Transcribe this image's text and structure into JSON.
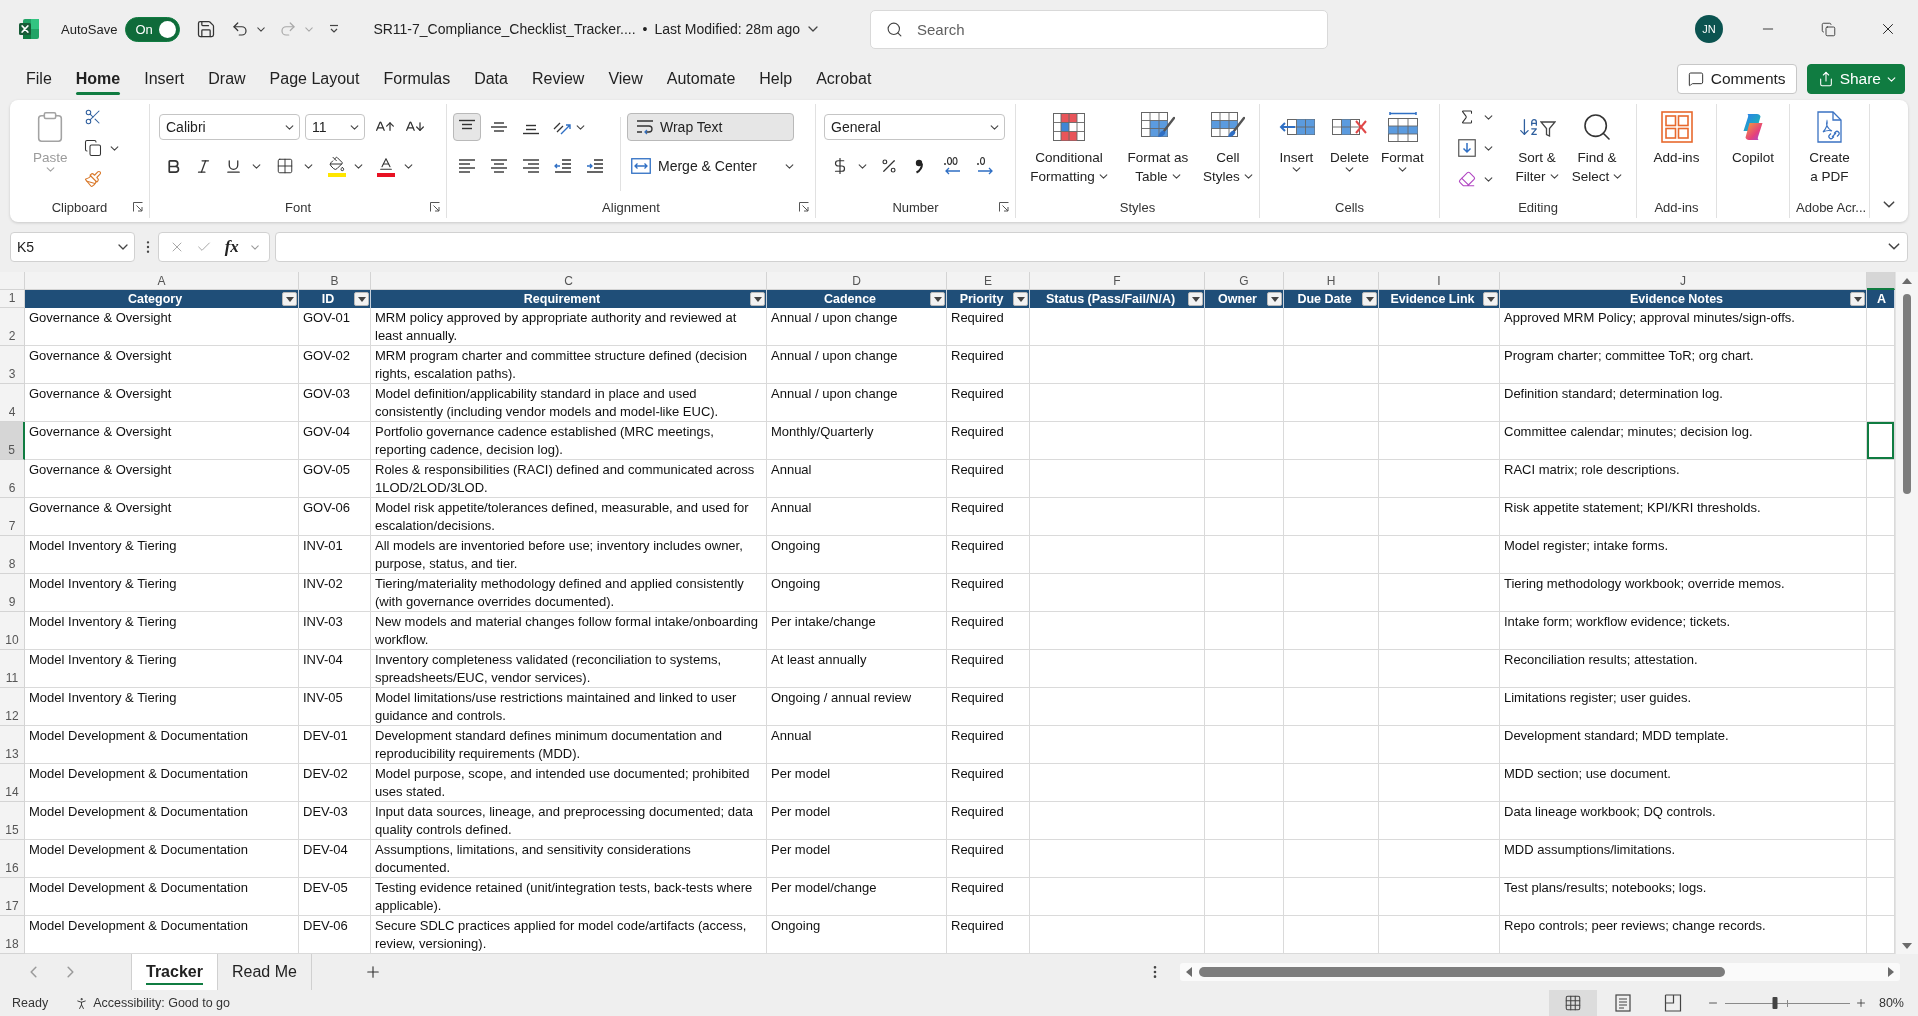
{
  "title_bar": {
    "autosave": {
      "label": "AutoSave",
      "toggle_text": "On",
      "on": true
    },
    "file_name": "SR11-7_Compliance_Checklist_Tracker....",
    "separator": "•",
    "last_modified": "Last Modified: 28m ago",
    "search": {
      "placeholder": "Search"
    },
    "avatar_initials": "JN"
  },
  "menu_tabs": [
    {
      "label": "File",
      "selected": false
    },
    {
      "label": "Home",
      "selected": true
    },
    {
      "label": "Insert",
      "selected": false
    },
    {
      "label": "Draw",
      "selected": false
    },
    {
      "label": "Page Layout",
      "selected": false
    },
    {
      "label": "Formulas",
      "selected": false
    },
    {
      "label": "Data",
      "selected": false
    },
    {
      "label": "Review",
      "selected": false
    },
    {
      "label": "View",
      "selected": false
    },
    {
      "label": "Automate",
      "selected": false
    },
    {
      "label": "Help",
      "selected": false
    },
    {
      "label": "Acrobat",
      "selected": false
    }
  ],
  "actions": {
    "comments": "Comments",
    "share": "Share"
  },
  "ribbon": {
    "clipboard": {
      "label": "Clipboard",
      "paste": {
        "label": "Paste",
        "disabled": true
      }
    },
    "font": {
      "label": "Font",
      "font_name": "Calibri",
      "font_size": "11"
    },
    "alignment": {
      "label": "Alignment",
      "vertical_align": [
        {
          "selected": true
        },
        {
          "selected": false
        },
        {
          "selected": false
        }
      ],
      "horizontal_align": [
        {
          "selected": false
        },
        {
          "selected": false
        },
        {
          "selected": false
        }
      ],
      "wrap_text": {
        "label": "Wrap Text",
        "on": true
      },
      "merge": {
        "label": "Merge & Center"
      }
    },
    "number": {
      "label": "Number",
      "format": "General"
    },
    "styles": {
      "label": "Styles",
      "buttons": [
        {
          "lines": [
            "Conditional",
            "Formatting"
          ]
        },
        {
          "lines": [
            "Format as",
            "Table"
          ]
        },
        {
          "lines": [
            "Cell",
            "Styles"
          ]
        }
      ]
    },
    "cells": {
      "label": "Cells",
      "buttons": [
        "Insert",
        "Delete",
        "Format"
      ]
    },
    "editing": {
      "label": "Editing",
      "buttons": [
        {
          "lines": [
            "Sort &",
            "Filter"
          ]
        },
        {
          "lines": [
            "Find &",
            "Select"
          ]
        }
      ]
    },
    "add_ins": {
      "label": "Add-ins",
      "button": "Add-ins"
    },
    "copilot": {
      "button": "Copilot"
    },
    "adobe": {
      "label": "Adobe Acr...",
      "button": {
        "lines": [
          "Create",
          "a PDF"
        ]
      }
    }
  },
  "formula_bar": {
    "name_box": "K5",
    "function_label": "fx"
  },
  "sheet": {
    "columns": [
      {
        "letter": "A",
        "header": "Category",
        "filter": true,
        "selected": false
      },
      {
        "letter": "B",
        "header": "ID",
        "filter": true,
        "selected": false
      },
      {
        "letter": "C",
        "header": "Requirement",
        "filter": true,
        "selected": false
      },
      {
        "letter": "D",
        "header": "Cadence",
        "filter": true,
        "selected": false
      },
      {
        "letter": "E",
        "header": "Priority",
        "filter": true,
        "selected": false
      },
      {
        "letter": "F",
        "header": "Status (Pass/Fail/N/A)",
        "filter": true,
        "selected": false
      },
      {
        "letter": "G",
        "header": "Owner",
        "filter": true,
        "selected": false
      },
      {
        "letter": "H",
        "header": "Due Date",
        "filter": true,
        "selected": false
      },
      {
        "letter": "I",
        "header": "Evidence Link",
        "filter": true,
        "selected": false
      },
      {
        "letter": "J",
        "header": "Evidence Notes",
        "filter": true,
        "selected": false
      },
      {
        "header": "A",
        "filter": false,
        "selected": true
      }
    ],
    "header_row_number": "1",
    "rows": [
      {
        "row_number": "2",
        "selected": false,
        "category": "Governance & Oversight",
        "id": "GOV-01",
        "requirement": "MRM policy approved by appropriate authority and reviewed at least annually.",
        "cadence": "Annual / upon change",
        "priority": "Required",
        "evidence_notes": "Approved MRM Policy; approval minutes/sign-offs."
      },
      {
        "row_number": "3",
        "selected": false,
        "category": "Governance & Oversight",
        "id": "GOV-02",
        "requirement": "MRM program charter and committee structure defined (decision rights, escalation paths).",
        "cadence": "Annual / upon change",
        "priority": "Required",
        "evidence_notes": "Program charter; committee ToR; org chart."
      },
      {
        "row_number": "4",
        "selected": false,
        "category": "Governance & Oversight",
        "id": "GOV-03",
        "requirement": "Model definition/applicability standard in place and used consistently (including vendor models and model-like EUC).",
        "cadence": "Annual / upon change",
        "priority": "Required",
        "evidence_notes": "Definition standard; determination log."
      },
      {
        "row_number": "5",
        "selected": true,
        "category": "Governance & Oversight",
        "id": "GOV-04",
        "requirement": "Portfolio governance cadence established (MRC meetings, reporting cadence, decision log).",
        "cadence": "Monthly/Quarterly",
        "priority": "Required",
        "evidence_notes": "Committee calendar; minutes; decision log."
      },
      {
        "row_number": "6",
        "selected": false,
        "category": "Governance & Oversight",
        "id": "GOV-05",
        "requirement": "Roles & responsibilities (RACI) defined and communicated across 1LOD/2LOD/3LOD.",
        "cadence": "Annual",
        "priority": "Required",
        "evidence_notes": "RACI matrix; role descriptions."
      },
      {
        "row_number": "7",
        "selected": false,
        "category": "Governance & Oversight",
        "id": "GOV-06",
        "requirement": "Model risk appetite/tolerances defined, measurable, and used for escalation/decisions.",
        "cadence": "Annual",
        "priority": "Required",
        "evidence_notes": "Risk appetite statement; KPI/KRI thresholds."
      },
      {
        "row_number": "8",
        "selected": false,
        "category": "Model Inventory & Tiering",
        "id": "INV-01",
        "requirement": "All models are inventoried before use; inventory includes owner, purpose, status, and tier.",
        "cadence": "Ongoing",
        "priority": "Required",
        "evidence_notes": "Model register; intake forms."
      },
      {
        "row_number": "9",
        "selected": false,
        "category": "Model Inventory & Tiering",
        "id": "INV-02",
        "requirement": "Tiering/materiality methodology defined and applied consistently (with governance overrides documented).",
        "cadence": "Ongoing",
        "priority": "Required",
        "evidence_notes": "Tiering methodology workbook; override memos."
      },
      {
        "row_number": "10",
        "selected": false,
        "category": "Model Inventory & Tiering",
        "id": "INV-03",
        "requirement": "New models and material changes follow formal intake/onboarding workflow.",
        "cadence": "Per intake/change",
        "priority": "Required",
        "evidence_notes": "Intake form; workflow evidence; tickets."
      },
      {
        "row_number": "11",
        "selected": false,
        "category": "Model Inventory & Tiering",
        "id": "INV-04",
        "requirement": "Inventory completeness validated (reconciliation to systems, spreadsheets/EUC, vendor services).",
        "cadence": "At least annually",
        "priority": "Required",
        "evidence_notes": "Reconciliation results; attestation."
      },
      {
        "row_number": "12",
        "selected": false,
        "category": "Model Inventory & Tiering",
        "id": "INV-05",
        "requirement": "Model limitations/use restrictions maintained and linked to user guidance and controls.",
        "cadence": "Ongoing / annual review",
        "priority": "Required",
        "evidence_notes": "Limitations register; user guides."
      },
      {
        "row_number": "13",
        "selected": false,
        "category": "Model Development & Documentation",
        "id": "DEV-01",
        "requirement": "Development standard defines minimum documentation and reproducibility requirements (MDD).",
        "cadence": "Annual",
        "priority": "Required",
        "evidence_notes": "Development standard; MDD template."
      },
      {
        "row_number": "14",
        "selected": false,
        "category": "Model Development & Documentation",
        "id": "DEV-02",
        "requirement": "Model purpose, scope, and intended use documented; prohibited uses stated.",
        "cadence": "Per model",
        "priority": "Required",
        "evidence_notes": "MDD section; use document."
      },
      {
        "row_number": "15",
        "selected": false,
        "category": "Model Development & Documentation",
        "id": "DEV-03",
        "requirement": "Input data sources, lineage, and preprocessing documented; data quality controls defined.",
        "cadence": "Per model",
        "priority": "Required",
        "evidence_notes": "Data lineage workbook; DQ controls."
      },
      {
        "row_number": "16",
        "selected": false,
        "category": "Model Development & Documentation",
        "id": "DEV-04",
        "requirement": "Assumptions, limitations, and sensitivity considerations documented.",
        "cadence": "Per model",
        "priority": "Required",
        "evidence_notes": "MDD assumptions/limitations."
      },
      {
        "row_number": "17",
        "selected": false,
        "category": "Model Development & Documentation",
        "id": "DEV-05",
        "requirement": "Testing evidence retained (unit/integration tests, back-tests where applicable).",
        "cadence": "Per model/change",
        "priority": "Required",
        "evidence_notes": "Test plans/results; notebooks; logs."
      },
      {
        "row_number": "18",
        "selected": false,
        "category": "Model Development & Documentation",
        "id": "DEV-06",
        "requirement": "Secure SDLC practices applied for model code/artifacts (access, review, versioning).",
        "cadence": "Ongoing",
        "priority": "Required",
        "evidence_notes": "Repo controls; peer reviews; change records."
      }
    ]
  },
  "sheet_tabs": [
    {
      "label": "Tracker",
      "selected": true
    },
    {
      "label": "Read Me",
      "selected": false
    }
  ],
  "status_bar": {
    "ready": "Ready",
    "accessibility": "Accessibility: Good to go",
    "views": [
      {
        "selected": true
      },
      {
        "selected": false
      },
      {
        "selected": false
      }
    ],
    "zoom": {
      "level": 0.4,
      "reading": "80%"
    }
  }
}
